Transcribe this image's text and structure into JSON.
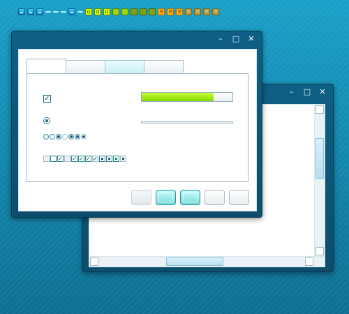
{
  "window_title_bar": {
    "controls": {
      "minimize": "–",
      "maximize": "□",
      "close": "✕"
    }
  },
  "progress": {
    "value": 0.79
  },
  "icons": [
    "minimize-icon",
    "maximize-icon",
    "close-icon",
    "check-icon",
    "radio-icon"
  ],
  "colors": {
    "accent": "#1aa0c8",
    "progress_fill": "#9be000",
    "button_active": "#8de3e0"
  }
}
